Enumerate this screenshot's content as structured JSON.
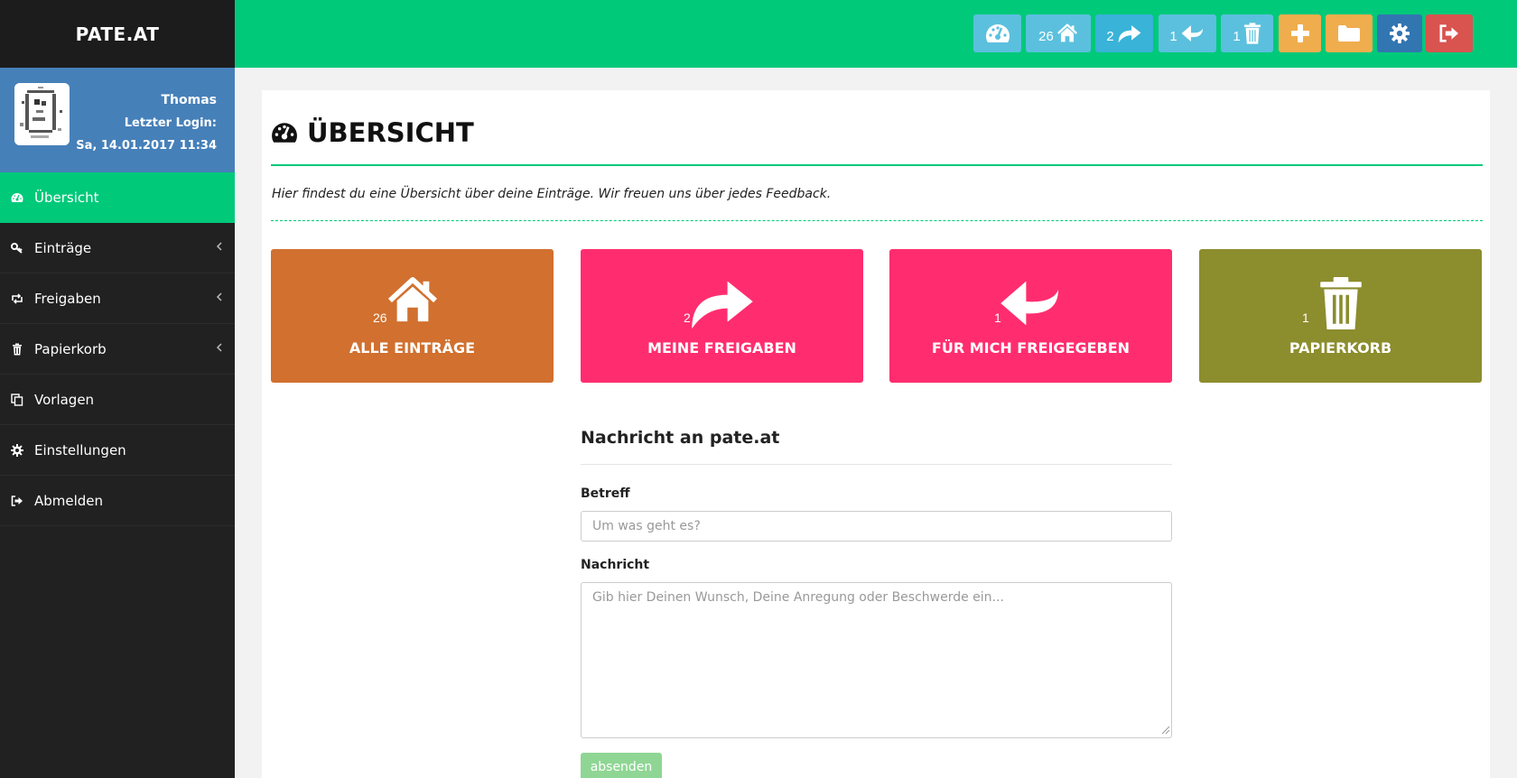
{
  "brand": "PATE.AT",
  "user": {
    "name": "Thomas",
    "last_login_label": "Letzter Login:",
    "last_login_value": "Sa, 14.01.2017 11:34"
  },
  "sidebar": {
    "items": [
      {
        "label": "Übersicht",
        "icon": "dashboard-icon",
        "active": true
      },
      {
        "label": "Einträge",
        "icon": "key-icon",
        "submenu": true
      },
      {
        "label": "Freigaben",
        "icon": "retweet-icon",
        "submenu": true
      },
      {
        "label": "Papierkorb",
        "icon": "trash-icon",
        "submenu": true
      },
      {
        "label": "Vorlagen",
        "icon": "copy-icon"
      },
      {
        "label": "Einstellungen",
        "icon": "gear-icon"
      },
      {
        "label": "Abmelden",
        "icon": "sign-out-icon"
      }
    ]
  },
  "toolbar": {
    "buttons": [
      {
        "icon": "dashboard-icon",
        "count": "",
        "color": "#5bc0de"
      },
      {
        "icon": "home-icon",
        "count": "26",
        "color": "#5bc0de"
      },
      {
        "icon": "share-icon",
        "count": "2",
        "color": "#39b3d7"
      },
      {
        "icon": "reply-icon",
        "count": "1",
        "color": "#5bc0de"
      },
      {
        "icon": "trash-icon",
        "count": "1",
        "color": "#5bc0de"
      },
      {
        "icon": "plus-icon",
        "count": "",
        "color": "#f0ad4e"
      },
      {
        "icon": "folder-icon",
        "count": "",
        "color": "#f0ad4e"
      },
      {
        "icon": "gear-icon",
        "count": "",
        "color": "#3276b1"
      },
      {
        "icon": "sign-out-icon",
        "count": "",
        "color": "#d9534f"
      }
    ]
  },
  "page": {
    "title": "ÜBERSICHT",
    "intro": "Hier findest du eine Übersicht über deine Einträge. Wir freuen uns über jedes Feedback."
  },
  "tiles": [
    {
      "label": "ALLE EINTRÄGE",
      "count": "26",
      "icon": "home-icon",
      "color": "#d1702f"
    },
    {
      "label": "MEINE FREIGABEN",
      "count": "2",
      "icon": "share-icon",
      "color": "#ff2d6f"
    },
    {
      "label": "FÜR MICH FREIGEGEBEN",
      "count": "1",
      "icon": "reply-icon",
      "color": "#ff2d6f"
    },
    {
      "label": "PAPIERKORB",
      "count": "1",
      "icon": "trash-icon",
      "color": "#8c8d2d"
    }
  ],
  "form": {
    "title": "Nachricht an pate.at",
    "subject_label": "Betreff",
    "subject_placeholder": "Um was geht es?",
    "message_label": "Nachricht",
    "message_placeholder": "Gib hier Deinen Wunsch, Deine Anregung oder Beschwerde ein...",
    "submit_label": "absenden"
  }
}
